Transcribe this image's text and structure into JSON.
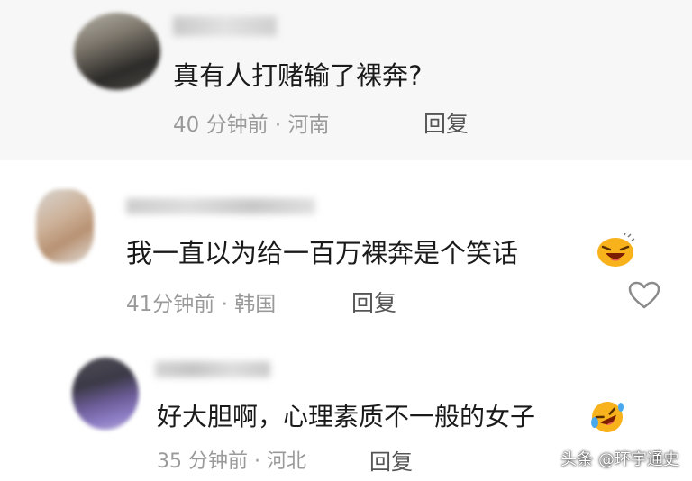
{
  "comments": [
    {
      "text": "真有人打赌输了裸奔?",
      "time": "40 分钟前",
      "location": "河南",
      "reply_label": "回复"
    },
    {
      "text": "我一直以为给一百万裸奔是个笑话",
      "time": "41分钟前",
      "location": "韩国",
      "reply_label": "回复"
    },
    {
      "text": "好大胆啊，心理素质不一般的女子",
      "time": "35 分钟前",
      "location": "河北",
      "reply_label": "回复"
    }
  ],
  "separator": "·",
  "watermark": "头条 @环宇通史",
  "icons": {
    "like": "heart-outline-icon",
    "emoji_laugh": "laughing-face-icon",
    "emoji_rofl": "rofl-face-icon"
  },
  "colors": {
    "meta": "#9a9a9a",
    "reply": "#555555",
    "emoji": "#f7b21c"
  }
}
